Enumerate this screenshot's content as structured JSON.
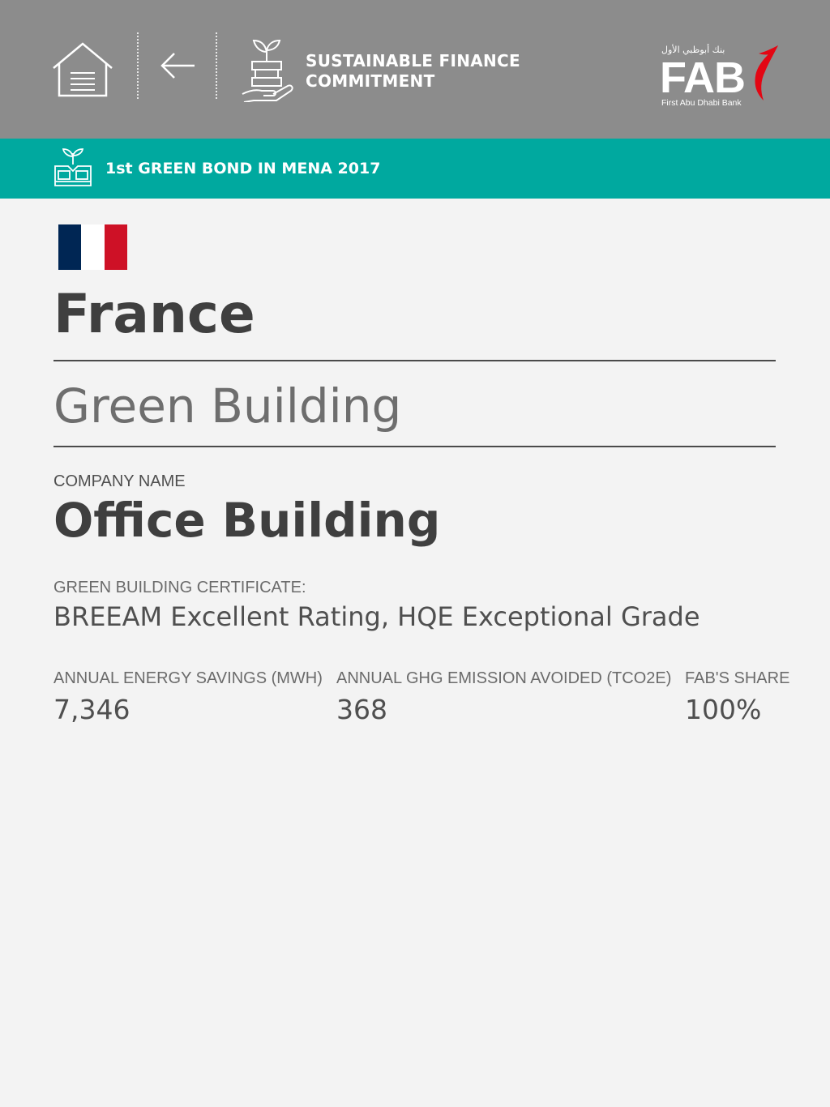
{
  "header": {
    "title": "SUSTAINABLE FINANCE COMMITMENT",
    "home_icon": "home-icon",
    "back_icon": "arrow-left-icon",
    "section_icon": "plant-hand-icon",
    "logo": {
      "arabic": "بنك أبوظبي الأول",
      "wordmark": "FAB",
      "subtitle": "First Abu Dhabi Bank"
    }
  },
  "banner": {
    "icon": "green-bond-icon",
    "text": "1st GREEN BOND IN MENA 2017"
  },
  "project": {
    "flag_icon": "france-flag-icon",
    "country": "France",
    "category": "Green Building",
    "company_label": "COMPANY NAME",
    "company": "Office Building",
    "certificate_label": "GREEN BUILDING CERTIFICATE:",
    "certificate": "BREEAM Excellent Rating, HQE Exceptional Grade"
  },
  "stats": [
    {
      "label": "ANNUAL ENERGY SAVINGS (MWH)",
      "value": "7,346"
    },
    {
      "label": "ANNUAL GHG EMISSION AVOIDED (TCO2E)",
      "value": "368"
    },
    {
      "label": "FAB'S SHARE",
      "value": "100%"
    }
  ],
  "colors": {
    "header_bg": "#8c8c8c",
    "banner_bg": "#00a99f",
    "page_bg": "#f3f3f3",
    "flag_blue": "#002654",
    "flag_white": "#ffffff",
    "flag_red": "#ce1126",
    "logo_accent": "#e30613"
  }
}
